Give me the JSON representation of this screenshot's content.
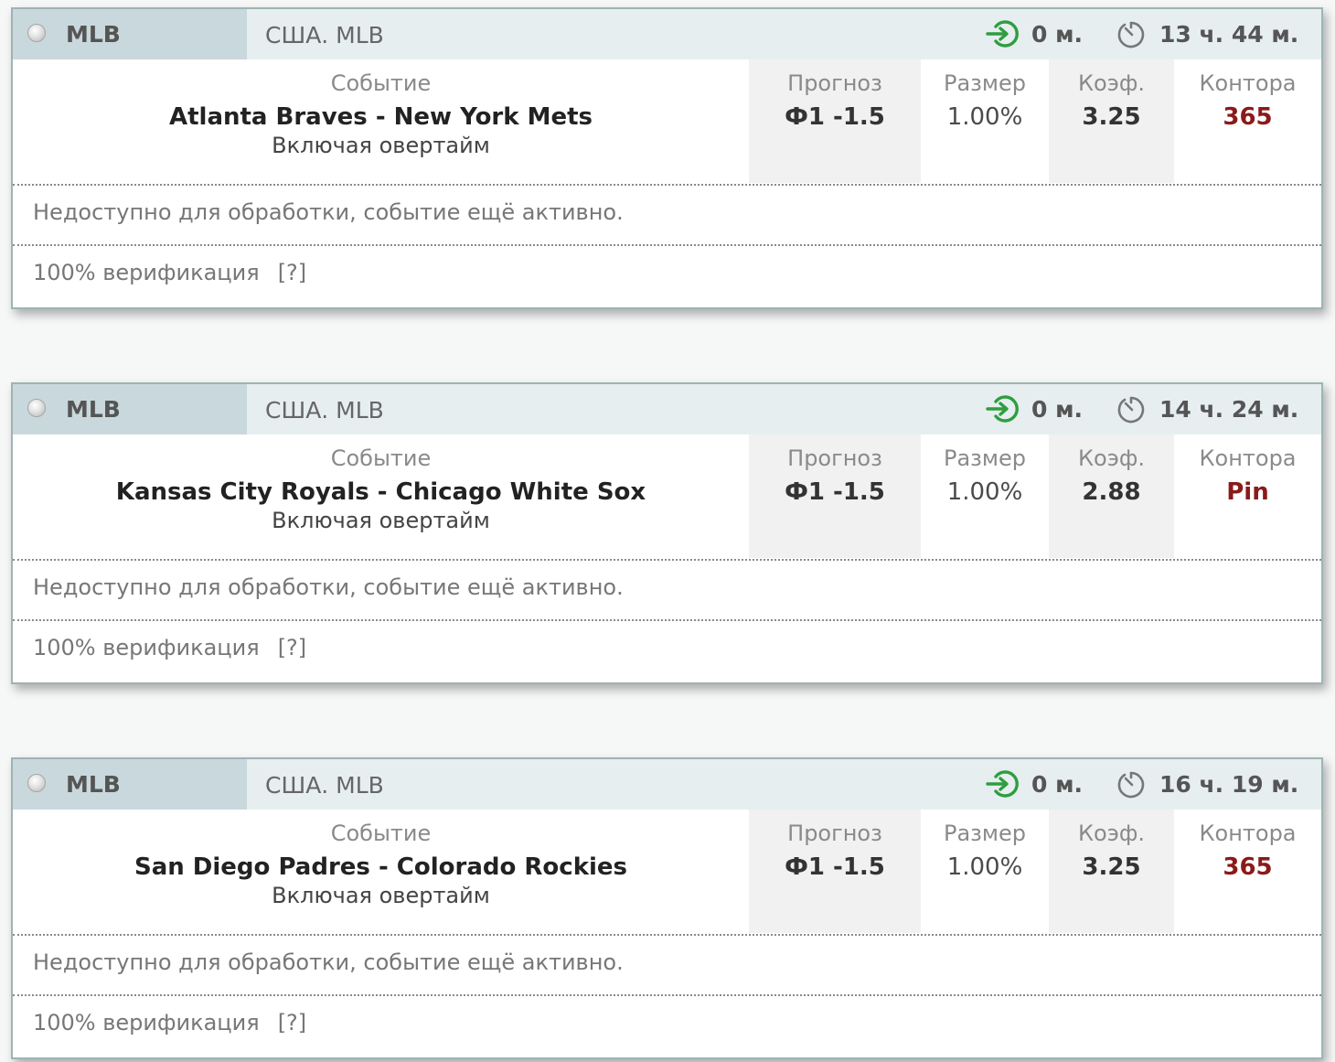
{
  "column_labels": {
    "event": "Событие",
    "forecast": "Прогноз",
    "size": "Размер",
    "coef": "Коэф.",
    "bookmaker": "Контора"
  },
  "cards": [
    {
      "league": "MLB",
      "country": "США. MLB",
      "minutes": "0 м.",
      "time_left": "13 ч. 44 м.",
      "event": "Atlanta Braves - New York Mets",
      "event_sub": "Включая овертайм",
      "forecast": "Ф1 -1.5",
      "size": "1.00%",
      "coef": "3.25",
      "bookmaker": "365",
      "status": "Недоступно для обработки, событие ещё активно.",
      "verification": "100% верификация",
      "help": "[?]"
    },
    {
      "league": "MLB",
      "country": "США. MLB",
      "minutes": "0 м.",
      "time_left": "14 ч. 24 м.",
      "event": "Kansas City Royals - Chicago White Sox",
      "event_sub": "Включая овертайм",
      "forecast": "Ф1 -1.5",
      "size": "1.00%",
      "coef": "2.88",
      "bookmaker": "Pin",
      "status": "Недоступно для обработки, событие ещё активно.",
      "verification": "100% верификация",
      "help": "[?]"
    },
    {
      "league": "MLB",
      "country": "США. MLB",
      "minutes": "0 м.",
      "time_left": "16 ч. 19 м.",
      "event": "San Diego Padres - Colorado Rockies",
      "event_sub": "Включая овертайм",
      "forecast": "Ф1 -1.5",
      "size": "1.00%",
      "coef": "3.25",
      "bookmaker": "365",
      "status": "Недоступно для обработки, событие ещё активно.",
      "verification": "100% верификация",
      "help": "[?]"
    }
  ],
  "icons": {
    "status": "radio-icon",
    "entry": "enter-arrow-icon",
    "timer": "stopwatch-icon"
  },
  "colors": {
    "header_bg": "#e6eef0",
    "league_tab_bg": "#c9d8dc",
    "border": "#9fb3b3",
    "bookmaker_red": "#8b1a1a",
    "entry_icon_green": "#2e9e3e"
  }
}
